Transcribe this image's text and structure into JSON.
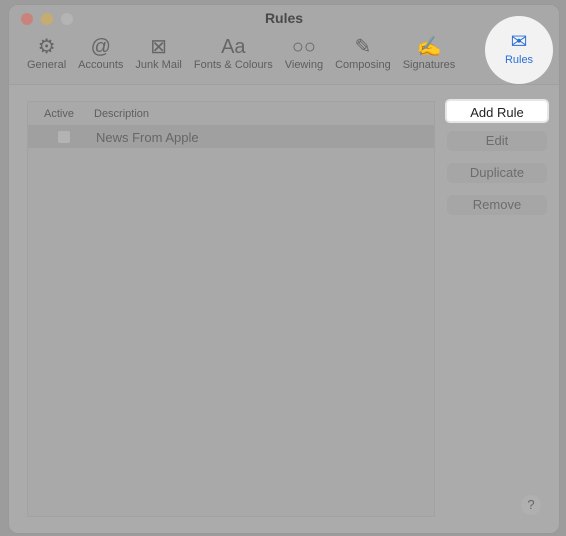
{
  "window": {
    "title": "Rules"
  },
  "toolbar": {
    "items": [
      {
        "label": "General",
        "icon": "⚙"
      },
      {
        "label": "Accounts",
        "icon": "@"
      },
      {
        "label": "Junk Mail",
        "icon": "⊠"
      },
      {
        "label": "Fonts & Colours",
        "icon": "Aa"
      },
      {
        "label": "Viewing",
        "icon": "○○"
      },
      {
        "label": "Composing",
        "icon": "✎"
      },
      {
        "label": "Signatures",
        "icon": "✍"
      }
    ],
    "active": {
      "label": "Rules",
      "icon": "✉"
    }
  },
  "list": {
    "columns": [
      "Active",
      "Description"
    ],
    "rows": [
      {
        "active": false,
        "description": "News From Apple"
      }
    ]
  },
  "buttons": {
    "add": "Add Rule",
    "edit": "Edit",
    "duplicate": "Duplicate",
    "remove": "Remove"
  },
  "help": "?",
  "colors": {
    "accent": "#2a6fd6"
  }
}
